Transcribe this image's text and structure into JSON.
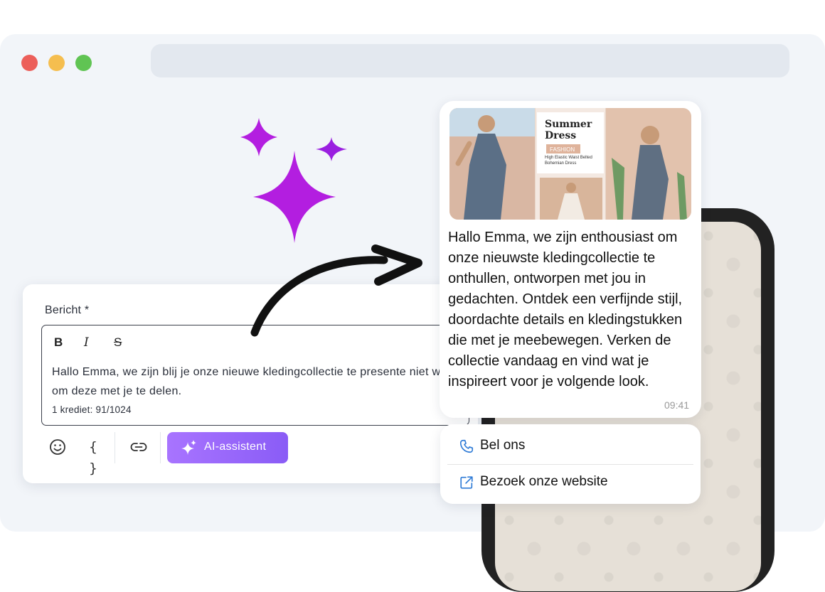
{
  "editor": {
    "label": "Bericht *",
    "format_buttons": {
      "bold": "B",
      "italic": "I",
      "strike": "S"
    },
    "message": "Hallo Emma, we zijn blij je onze nieuwe kledingcollectie te presente niet wachten om deze met je te delen.",
    "credit": "1 krediet: 91/1024",
    "variables_label": "{ }",
    "ai_button_label": "AI-assistent"
  },
  "preview": {
    "promo": {
      "title_line1": "Summer",
      "title_line2": "Dress",
      "tag": "FASHION",
      "subtitle": "High Elastic Waist Belted Bohemian Dress"
    },
    "message": "Hallo Emma, we zijn enthousiast om onze nieuwste kledingcollectie te onthullen, ontworpen met jou in gedachten. Ontdek een verfijnde stijl, doordachte details en kledingstukken die met je meebewegen. Verken de collectie vandaag en vind wat je inspireert voor je volgende look.",
    "time": "09:41",
    "buttons": [
      {
        "label": "Bel ons",
        "icon": "phone-icon"
      },
      {
        "label": "Bezoek onze website",
        "icon": "external-link-icon"
      }
    ]
  },
  "colors": {
    "accent": "#8a5cf6",
    "sparkle": "#b31ee0",
    "link_icon": "#2f7bd6"
  }
}
